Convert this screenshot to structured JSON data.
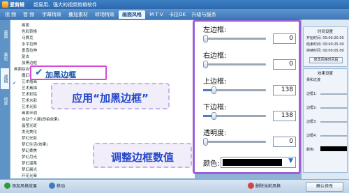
{
  "titlebar": {
    "app_name": "爱剪辑",
    "tagline": "超易用、强大的视频剪辑软件"
  },
  "tabs": [
    {
      "label": "视 频"
    },
    {
      "label": "音 频"
    },
    {
      "label": "字幕特效"
    },
    {
      "label": "叠加素材"
    },
    {
      "label": "转场特效"
    },
    {
      "label": "画面风格",
      "active": true
    },
    {
      "label": "M T V"
    },
    {
      "label": "卡拉OK"
    },
    {
      "label": "升级与服务"
    }
  ],
  "vtabs": [
    {
      "label": "画面"
    },
    {
      "label": "美化"
    },
    {
      "label": "滤镜",
      "active": true
    },
    {
      "label": "动景"
    }
  ],
  "effects": {
    "items_top": [
      "画面",
      "色彩转换",
      "马赛克",
      "水平拉伸",
      "垂直拉伸",
      "复古",
      "加黑边框"
    ],
    "group": "画面综合效果",
    "items_bottom": [
      "魔幻视觉",
      "艺术插画",
      "艺术素描",
      "艺术彩铅",
      "艺术水彩",
      "艺术光影",
      "画面半调",
      "自动个人展(即拍效果)",
      "晶莹光斑",
      "发光美化",
      "梦幻光影",
      "梦幻生活(效果)",
      "梦幻柔焦",
      "梦幻月光",
      "梦幻温柔",
      "梦幻晨光",
      "开花光晕",
      "画面漫画",
      "古典水彩",
      "素描"
    ]
  },
  "highlight": {
    "label": "加黑边框"
  },
  "callouts": {
    "apply": "应用“加黑边框”",
    "adjust": "调整边框数值"
  },
  "params": [
    {
      "label": "左边框:",
      "value": "0",
      "percent": 0
    },
    {
      "label": "右边框:",
      "value": "0",
      "percent": 0
    },
    {
      "label": "上边框:",
      "value": "138",
      "percent": 15
    },
    {
      "label": "下边框:",
      "value": "138",
      "percent": 15
    },
    {
      "label": "透明度:",
      "value": "0",
      "percent": 0
    }
  ],
  "color": {
    "label": "颜色:",
    "value": "#000000"
  },
  "side": {
    "time_title": "时间设置",
    "time_rows": [
      "开始时间: 00:00:20.00",
      "结束时间: 00:00:25.00",
      "持续时间: 00:00:05.00"
    ],
    "time_button": "修改风格时间段",
    "effect_title": "效果设置",
    "effect_rows": [
      "柔和过渡",
      "边框1:",
      "边框2:",
      "边框3:",
      "边框4:",
      "颜色:"
    ]
  },
  "bottom": {
    "add": "添加风格效果",
    "remove": "移动",
    "delete": "删除当前风格",
    "confirm": "确认修改"
  }
}
